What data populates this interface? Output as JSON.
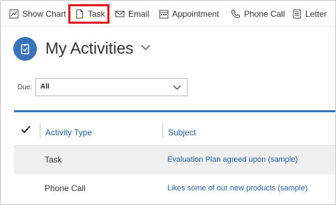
{
  "toolbar": {
    "items": [
      {
        "label": "Show Chart",
        "icon": "chart-icon"
      },
      {
        "label": "Task",
        "icon": "task-icon"
      },
      {
        "label": "Email",
        "icon": "email-icon"
      },
      {
        "label": "Appointment",
        "icon": "calendar-icon"
      },
      {
        "label": "Phone Call",
        "icon": "phone-icon"
      },
      {
        "label": "Letter",
        "icon": "letter-icon"
      }
    ],
    "highlight_color": "#e0141b"
  },
  "header": {
    "title": "My Activities",
    "icon": "activity-icon",
    "icon_color": "#3b73b9"
  },
  "filter": {
    "label": "Due:",
    "value": "All"
  },
  "grid": {
    "columns": [
      "Activity Type",
      "Subject"
    ],
    "rows": [
      {
        "type": "Task",
        "subject": "Evaluation Plan agreed upon (sample)"
      },
      {
        "type": "Phone Call",
        "subject": "Likes some of our new products (sample)"
      }
    ],
    "accent_color": "#3b73b9",
    "link_color": "#1f5fa8"
  }
}
